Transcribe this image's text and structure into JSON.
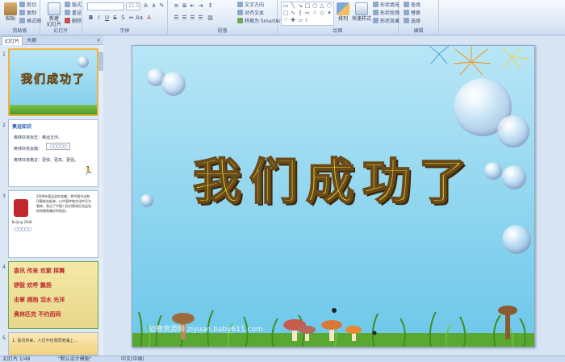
{
  "ribbon": {
    "clipboard": {
      "paste": "粘贴",
      "cut": "剪切",
      "copy": "复制",
      "format_painter": "格式刷",
      "label": "剪贴板"
    },
    "slides": {
      "new_slide": "新建\n幻灯片",
      "layout": "版式",
      "reset": "重设",
      "delete": "删除",
      "label": "幻灯片"
    },
    "font": {
      "font_name": "",
      "font_size": "11.5",
      "label": "字体"
    },
    "paragraph": {
      "text_direction": "文字方向",
      "align_text": "对齐文本",
      "smartart": "转换为 SmartArt",
      "label": "段落"
    },
    "drawing": {
      "arrange": "排列",
      "quick_styles": "快速样式",
      "shape_fill": "形状填充",
      "shape_outline": "形状轮廓",
      "shape_effects": "形状效果",
      "label": "绘图"
    },
    "editing": {
      "find": "查找",
      "replace": "替换",
      "select": "选择",
      "label": "编辑"
    }
  },
  "left_pane": {
    "tabs": [
      "幻灯片",
      "大纲"
    ],
    "close": "×",
    "thumbnails": [
      {
        "num": "1",
        "title": "我们成功了"
      },
      {
        "num": "2",
        "heading": "奥运知识",
        "lines": [
          "奥林匹克标志：奥运五环。",
          "奥林匹克会旗：",
          "奥林匹克格言：更快、更高、更强。"
        ]
      },
      {
        "num": "3",
        "text": "2008年奥运会的会徽，将中国书法和印章结合起来，以中国传统文化符号为载体，表达了中国人民对奥林匹克运动的热情和美好的祝愿。",
        "logo_text": "Beijing 2008"
      },
      {
        "num": "4",
        "rows": [
          "喜讯  传来  欢聚  挥舞",
          "锣鼓  欢呼  飘扬",
          "击掌  拥抱  泪水  光洋",
          "奥林匹克  不约而同"
        ]
      },
      {
        "num": "5",
        "text": "1. 喜讯传来，人们不约而同地涌上..."
      }
    ]
  },
  "slide": {
    "title": "我们成功了",
    "watermark": "幼教资源网 ziyuan.baby611.com"
  },
  "status": {
    "slide_info": "幻灯片 1/48",
    "theme": "\"默认设计模板\"",
    "language": "中文(中国)"
  },
  "colors": {
    "title_fill": "#f6ef2a",
    "title_outline": "#6a4a1a",
    "slide_bg_top": "#b8e6f6",
    "slide_bg_bottom": "#6cc7ea",
    "selection": "#f0b33f"
  }
}
